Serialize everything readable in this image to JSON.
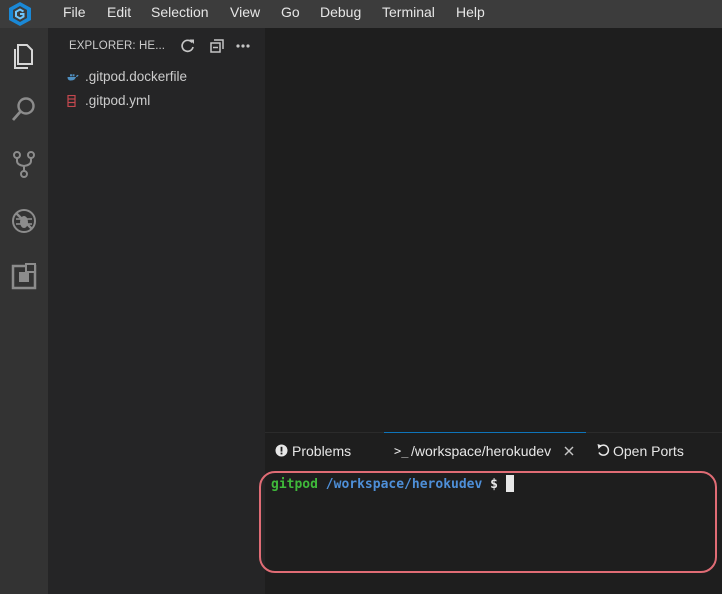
{
  "menubar": {
    "items": [
      "File",
      "Edit",
      "Selection",
      "View",
      "Go",
      "Debug",
      "Terminal",
      "Help"
    ]
  },
  "activitybar": {
    "icons": [
      "files-icon",
      "search-icon",
      "source-control-icon",
      "debug-icon",
      "extensions-icon"
    ]
  },
  "sidebar": {
    "title": "EXPLORER: HE...",
    "files": [
      ".gitpod.dockerfile",
      ".gitpod.yml"
    ]
  },
  "panel": {
    "tabs": {
      "problems": "Problems",
      "terminal": "/workspace/herokudev",
      "ports": "Open Ports"
    },
    "terminal": {
      "user": "gitpod",
      "path": "/workspace/herokudev",
      "prompt": "$"
    }
  },
  "colors": {
    "accent": "#0e74ba",
    "prompt_user": "#3fb93a",
    "prompt_path": "#4e8fd8",
    "highlight": "#e06c75"
  }
}
